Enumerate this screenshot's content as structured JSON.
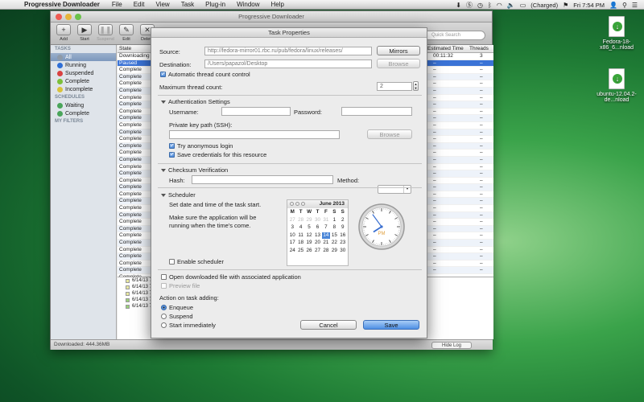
{
  "menubar": {
    "app_name": "Progressive Downloader",
    "menus": [
      "File",
      "Edit",
      "View",
      "Task",
      "Plug-in",
      "Window",
      "Help"
    ],
    "battery": "(Charged)",
    "clock": "Fri 7:54 PM"
  },
  "desktop": {
    "icons": [
      {
        "label": "Fedora-18-x86_6...nload"
      },
      {
        "label": "ubuntu-12.04.2-de...nload"
      }
    ]
  },
  "mainwin": {
    "title": "Progressive Downloader",
    "toolbar": [
      "Add",
      "Start",
      "Suspend",
      "Edit",
      "Delete"
    ],
    "search_placeholder": "Quick Search",
    "sidebar": {
      "tasks_header": "TASKS",
      "items": [
        {
          "label": "All",
          "color": "#8e9aa8"
        },
        {
          "label": "Running",
          "color": "#2f6fd6"
        },
        {
          "label": "Suspended",
          "color": "#d94141"
        },
        {
          "label": "Complete",
          "color": "#7cbf3a"
        },
        {
          "label": "Incomplete",
          "color": "#d9c23a"
        }
      ],
      "schedules_header": "SCHEDULES",
      "schedules": [
        {
          "label": "Waiting",
          "color": "#4aa55a"
        },
        {
          "label": "Complete",
          "color": "#4aa55a"
        }
      ],
      "filters_header": "MY FILTERS"
    },
    "columns": {
      "state": "State",
      "estimated": "Estimated Time",
      "threads": "Threads"
    },
    "rows": [
      {
        "state": "Downloading",
        "est": "00:11:32",
        "threads": "3"
      },
      {
        "state": "Paused",
        "est": "–",
        "threads": "–"
      },
      {
        "state": "Complete",
        "est": "–",
        "threads": "–"
      },
      {
        "state": "Complete",
        "est": "–",
        "threads": "–"
      },
      {
        "state": "Complete",
        "est": "–",
        "threads": "–"
      },
      {
        "state": "Complete",
        "est": "–",
        "threads": "–"
      },
      {
        "state": "Complete",
        "est": "–",
        "threads": "–"
      },
      {
        "state": "Complete",
        "est": "–",
        "threads": "–"
      },
      {
        "state": "Complete",
        "est": "–",
        "threads": "–"
      },
      {
        "state": "Complete",
        "est": "–",
        "threads": "–"
      },
      {
        "state": "Complete",
        "est": "–",
        "threads": "–"
      },
      {
        "state": "Complete",
        "est": "–",
        "threads": "–"
      },
      {
        "state": "Complete",
        "est": "–",
        "threads": "–"
      },
      {
        "state": "Complete",
        "est": "–",
        "threads": "–"
      },
      {
        "state": "Complete",
        "est": "–",
        "threads": "–"
      },
      {
        "state": "Complete",
        "est": "–",
        "threads": "–"
      },
      {
        "state": "Complete",
        "est": "–",
        "threads": "–"
      },
      {
        "state": "Complete",
        "est": "–",
        "threads": "–"
      },
      {
        "state": "Complete",
        "est": "–",
        "threads": "–"
      },
      {
        "state": "Complete",
        "est": "–",
        "threads": "–"
      },
      {
        "state": "Complete",
        "est": "–",
        "threads": "–"
      },
      {
        "state": "Complete",
        "est": "–",
        "threads": "–"
      },
      {
        "state": "Complete",
        "est": "–",
        "threads": "–"
      },
      {
        "state": "Complete",
        "est": "–",
        "threads": "–"
      },
      {
        "state": "Complete",
        "est": "–",
        "threads": "–"
      },
      {
        "state": "Complete",
        "est": "–",
        "threads": "–"
      },
      {
        "state": "Complete",
        "est": "–",
        "threads": "–"
      },
      {
        "state": "Complete",
        "est": "–",
        "threads": "–"
      },
      {
        "state": "Complete",
        "est": "–",
        "threads": "–"
      },
      {
        "state": "Complete",
        "est": "–",
        "threads": "–"
      },
      {
        "state": "Complete",
        "est": "–",
        "threads": "–"
      },
      {
        "state": "Complete",
        "est": "–",
        "threads": "–"
      },
      {
        "state": "Complete",
        "est": "–",
        "threads": "–"
      }
    ],
    "log": [
      {
        "text": "6/14/13 7:5",
        "color": "#e8e8a0"
      },
      {
        "text": "6/14/13 7:5",
        "color": "#e8e8a0"
      },
      {
        "text": "6/14/13 7:5",
        "color": "#e8e8a0"
      },
      {
        "text": "6/14/13 7:5",
        "color": "#9bd17a"
      },
      {
        "text": "6/14/13 7:5",
        "color": "#9bd17a"
      }
    ],
    "status": "Downloaded: 444.36MB",
    "hide_log": "Hide Log"
  },
  "sheet": {
    "title": "Task Properties",
    "source_label": "Source:",
    "source_value": "http://fedora-mirror01.rbc.ru/pub/fedora/linux/releases/",
    "mirrors": "Mirrors",
    "destination_label": "Destination:",
    "destination_value": "/Users/papazol/Desktop",
    "browse": "Browse",
    "auto_thread": "Automatic thread count control",
    "max_thread_label": "Maximum thread count:",
    "max_thread_value": "2",
    "auth_header": "Authentication Settings",
    "username_label": "Username:",
    "password_label": "Password:",
    "private_key_label": "Private key path (SSH):",
    "browse2": "Browse",
    "anon_login": "Try anonymous login",
    "save_creds": "Save credentials for this resource",
    "checksum_header": "Checksum Verification",
    "hash_label": "Hash:",
    "method_label": "Method:",
    "scheduler_header": "Scheduler",
    "sched_text1": "Set date and time of the task start.",
    "sched_text2": "Make sure the application will be running when the time's come.",
    "enable_scheduler": "Enable scheduler",
    "calendar": {
      "month": "June 2013",
      "weekdays": [
        "M",
        "T",
        "W",
        "T",
        "F",
        "S",
        "S"
      ],
      "days": [
        "27",
        "28",
        "29",
        "30",
        "31",
        "1",
        "2",
        "3",
        "4",
        "5",
        "6",
        "7",
        "8",
        "9",
        "10",
        "11",
        "12",
        "13",
        "14",
        "15",
        "16",
        "17",
        "18",
        "19",
        "20",
        "21",
        "22",
        "23",
        "24",
        "25",
        "26",
        "27",
        "28",
        "29",
        "30"
      ],
      "today_index": 18
    },
    "clock": {
      "label": "PM",
      "hour": 7,
      "minute": 54
    },
    "open_file": "Open downloaded file with associated application",
    "preview_file": "Preview file",
    "action_label": "Action on task adding:",
    "enqueue": "Enqueue",
    "suspend": "Suspend",
    "start_immediately": "Start immediately",
    "cancel": "Cancel",
    "save": "Save"
  }
}
